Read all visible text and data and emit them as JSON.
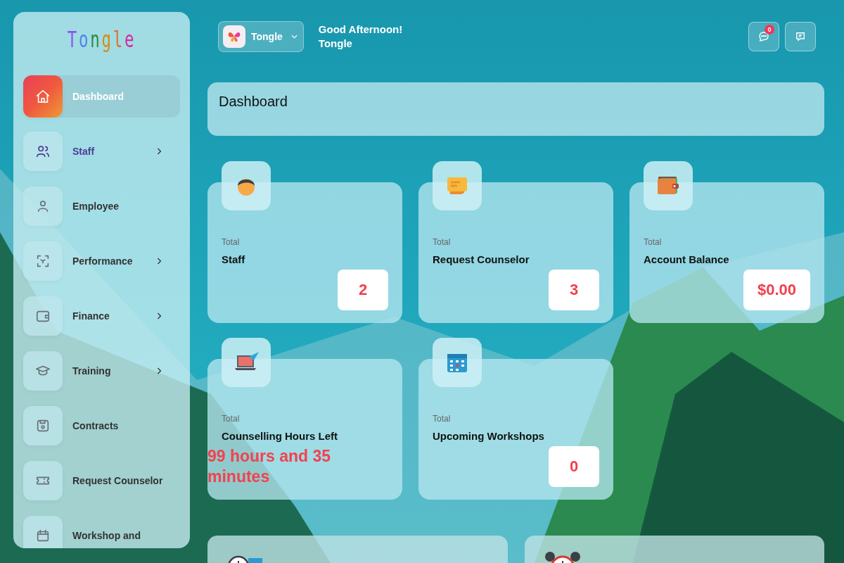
{
  "sidebar": {
    "logo": "Tongle",
    "items": [
      {
        "label": "Dashboard",
        "selected": true,
        "hovered": false,
        "has_submenu": false
      },
      {
        "label": "Staff",
        "selected": false,
        "hovered": true,
        "has_submenu": true
      },
      {
        "label": "Employee",
        "selected": false,
        "hovered": false,
        "has_submenu": false
      },
      {
        "label": "Performance",
        "selected": false,
        "hovered": false,
        "has_submenu": true
      },
      {
        "label": "Finance",
        "selected": false,
        "hovered": false,
        "has_submenu": true
      },
      {
        "label": "Training",
        "selected": false,
        "hovered": false,
        "has_submenu": true
      },
      {
        "label": "Contracts",
        "selected": false,
        "hovered": false,
        "has_submenu": false
      },
      {
        "label": "Request Counselor",
        "selected": false,
        "hovered": false,
        "has_submenu": false
      },
      {
        "label": "Workshop and",
        "selected": false,
        "hovered": false,
        "has_submenu": false
      }
    ]
  },
  "header": {
    "org_switcher": {
      "label": "Tongle"
    },
    "greeting": "Good Afternoon!",
    "user_name": "Tongle",
    "notifications_badge": "0"
  },
  "page_title": "Dashboard",
  "cards": [
    {
      "caption": "Total",
      "label": "Staff",
      "value": "2",
      "kind": "box"
    },
    {
      "caption": "Total",
      "label": "Request Counselor",
      "value": "3",
      "kind": "box"
    },
    {
      "caption": "Total",
      "label": "Account Balance",
      "value": "$0.00",
      "kind": "box"
    },
    {
      "caption": "Total",
      "label": "Counselling Hours Left",
      "value": "99 hours and 35 minutes",
      "kind": "text"
    },
    {
      "caption": "Total",
      "label": "Upcoming Workshops",
      "value": "0",
      "kind": "box"
    }
  ]
}
